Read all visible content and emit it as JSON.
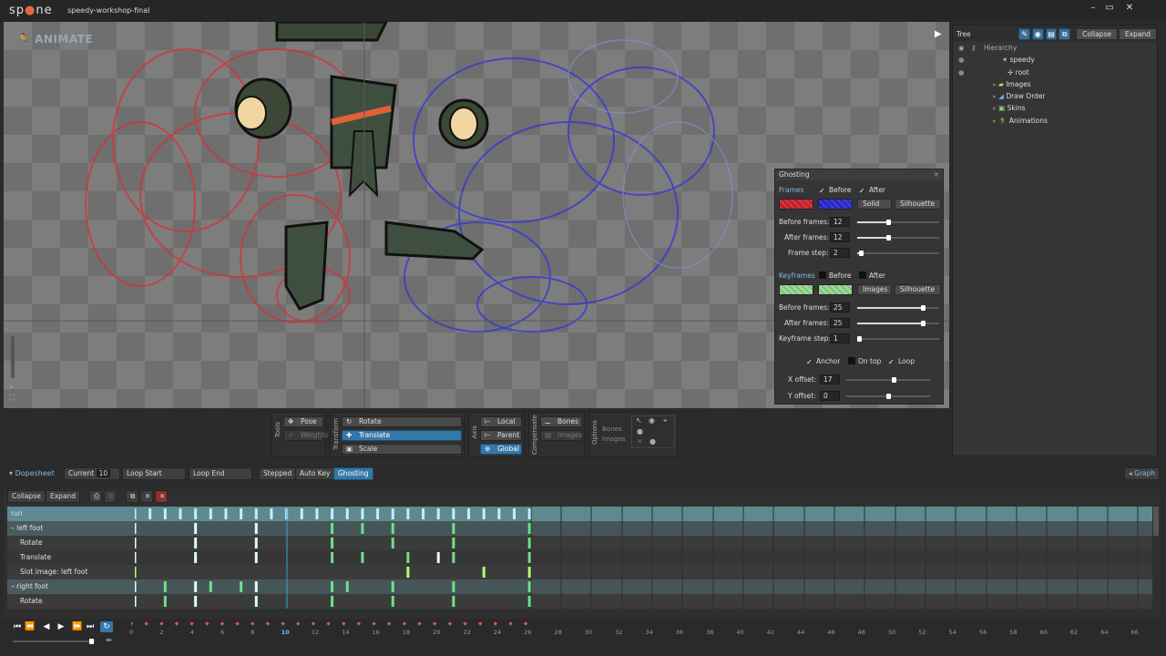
{
  "titlebar": {
    "logo": "sp ne",
    "project": "speedy-workshop-final"
  },
  "viewport": {
    "mode_label": "ANIMATE"
  },
  "tree": {
    "title": "Tree",
    "collapse": "Collapse",
    "expand": "Expand",
    "hierarchy": "Hierarchy",
    "items": [
      "speedy",
      "root",
      "Images",
      "Draw Order",
      "Skins",
      "Animations"
    ]
  },
  "ghosting": {
    "title": "Ghosting",
    "frames_label": "Frames",
    "before": "Before",
    "after": "After",
    "frames_mode": "Solid",
    "frames_style": "Silhouette",
    "before_frames_label": "Before frames:",
    "before_frames": "12",
    "after_frames_label": "After frames:",
    "after_frames": "12",
    "frame_step_label": "Frame step:",
    "frame_step": "2",
    "keyframes_label": "Keyframes",
    "kf_mode": "Images",
    "kf_style": "Silhouette",
    "kf_before_frames": "25",
    "kf_after_frames": "25",
    "keyframe_step_label": "Keyframe step:",
    "keyframe_step": "1",
    "anchor": "Anchor",
    "on_top": "On top",
    "loop": "Loop",
    "x_offset_label": "X offset:",
    "x_offset": "17",
    "y_offset_label": "Y offset:",
    "y_offset": "0",
    "colors": {
      "before": "#d8323a",
      "after": "#3a3adc",
      "kf": "#9fd89a"
    }
  },
  "toolbar": {
    "tools_label": "Tools",
    "pose": "Pose",
    "weights": "Weights",
    "transform_label": "Transform",
    "rotate": "Rotate",
    "translate": "Translate",
    "scale": "Scale",
    "axis_label": "Axis",
    "local": "Local",
    "parent": "Parent",
    "global": "Global",
    "compensate_label": "Compensate",
    "bones": "Bones",
    "images": "Images",
    "options_label": "Options",
    "opt_bones": "Bones",
    "opt_images": "Images"
  },
  "dopesheet": {
    "title": "Dopesheet",
    "current_label": "Current",
    "current": "10",
    "loop_start": "Loop Start",
    "loop_end": "Loop End",
    "stepped": "Stepped",
    "auto_key": "Auto Key",
    "ghosting": "Ghosting",
    "graph": "Graph",
    "collapse": "Collapse",
    "expand": "Expand",
    "rows": [
      "run",
      "left foot",
      "Rotate",
      "Translate",
      "Slot image: left foot",
      "right foot",
      "Rotate"
    ],
    "ruler": [
      "0",
      "2",
      "4",
      "6",
      "8",
      "10",
      "12",
      "14",
      "16",
      "18",
      "20",
      "22",
      "24",
      "26",
      "28",
      "30",
      "32",
      "34",
      "36",
      "38",
      "40",
      "42",
      "44",
      "46",
      "48",
      "50",
      "52",
      "54",
      "56",
      "58",
      "60",
      "62",
      "64",
      "66"
    ]
  }
}
